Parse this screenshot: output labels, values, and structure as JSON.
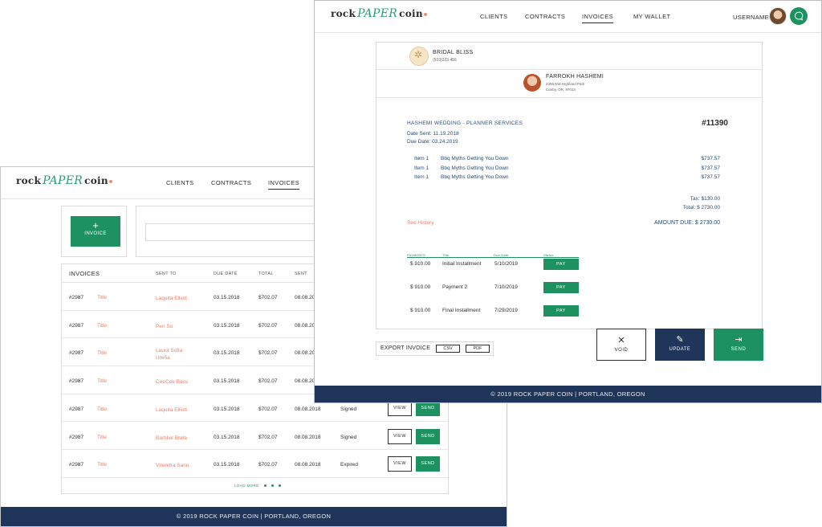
{
  "brand": {
    "logo_left": "rock",
    "logo_mid": "PAPER",
    "logo_right": "coin"
  },
  "nav": {
    "clients": "CLIENTS",
    "contracts": "CONTRACTS",
    "invoices": "INVOICES",
    "wallet": "MY WALLET"
  },
  "user": {
    "name": "USERNAME"
  },
  "footer": "© 2019 ROCK PAPER COIN | PORTLAND, OREGON",
  "list_page": {
    "new_invoice": {
      "plus": "+",
      "label": "INVOICE"
    },
    "table": {
      "title": "INVOICES",
      "headers": {
        "sent_to": "SENT TO",
        "due_date": "DUE DATE",
        "total": "TOTAL",
        "sent": "SENT"
      },
      "rows": [
        {
          "id": "#2987",
          "title": "Title",
          "sent_to": "Laquita Elliott",
          "due": "03.15.2018",
          "total": "$702.07",
          "sent": "08.08.20",
          "status": ""
        },
        {
          "id": "#2987",
          "title": "Title",
          "sent_to": "Pen Su",
          "due": "03.15.2018",
          "total": "$702.07",
          "sent": "08.08.20",
          "status": ""
        },
        {
          "id": "#2987",
          "title": "Title",
          "sent_to": "Laura Sofia Ureña",
          "due": "03.15.2018",
          "total": "$702.07",
          "sent": "08.08.20",
          "status": ""
        },
        {
          "id": "#2987",
          "title": "Title",
          "sent_to": "CeeCee Bass",
          "due": "03.15.2018",
          "total": "$702.07",
          "sent": "08.08.20",
          "status": ""
        },
        {
          "id": "#2987",
          "title": "Title",
          "sent_to": "Laquita Elliott",
          "due": "03.15.2018",
          "total": "$702.07",
          "sent": "08.08.2018",
          "status": "Signed"
        },
        {
          "id": "#2987",
          "title": "Title",
          "sent_to": "Barbliel Brata",
          "due": "03.15.2018",
          "total": "$702.07",
          "sent": "08.08.2018",
          "status": "Signed"
        },
        {
          "id": "#2987",
          "title": "Title",
          "sent_to": "Virendra Sanu",
          "due": "03.15.2018",
          "total": "$702.07",
          "sent": "08.08.2018",
          "status": "Expired"
        }
      ],
      "view_label": "VIEW",
      "send_label": "SEND",
      "load_more": "LOAD MORE"
    }
  },
  "invoice": {
    "vendor": {
      "name": "BRIDAL BLISS",
      "phone": "(503)323 456"
    },
    "client": {
      "name": "FARROKH HASHEMI",
      "address1": "2356 NW Highland Park",
      "address2": "Canby, OR, 97013"
    },
    "project": "HASHEMI WEDDING - PLANNER SERVICES",
    "number": "#11390",
    "date_sent": "Date Sent: 11.19.2018",
    "due_date": "Due Date: 03.24.2019",
    "items": [
      {
        "label": "Item 1",
        "desc": "Bbq Myths Getting You Down",
        "amount": "$737.57"
      },
      {
        "label": "Item 1",
        "desc": "Bbq Myths Getting You Down",
        "amount": "$737.57"
      },
      {
        "label": "Item 1",
        "desc": "Bbq Myths Getting You Down",
        "amount": "$737.57"
      }
    ],
    "tax": "Tax: $130.00",
    "total": "Total: $ 2730.00",
    "see_history": "See History",
    "amount_due": "AMOUNT DUE: $ 2730.00",
    "payments_headers": {
      "payments": "PAYMENTS",
      "title": "Title",
      "due": "Due Date",
      "status": "Status"
    },
    "payments": [
      {
        "amount": "$ 910.00",
        "title": "Initial Installment",
        "date": "5/10/2019",
        "action": "PAY"
      },
      {
        "amount": "$ 910.00",
        "title": "Payment 2",
        "date": "7/10/2019",
        "action": "PAY"
      },
      {
        "amount": "$ 910.00",
        "title": "Final Installment",
        "date": "7/29/2019",
        "action": "PAY"
      }
    ],
    "export": {
      "label": "EXPORT INVOICE",
      "csv": "CSV",
      "pdf": "PDF"
    },
    "actions": {
      "void": "VOID",
      "update": "UPDATE",
      "send": "SEND"
    }
  },
  "colors": {
    "green": "#1e9160",
    "navy": "#1f3559",
    "salmon": "#e8826c"
  }
}
